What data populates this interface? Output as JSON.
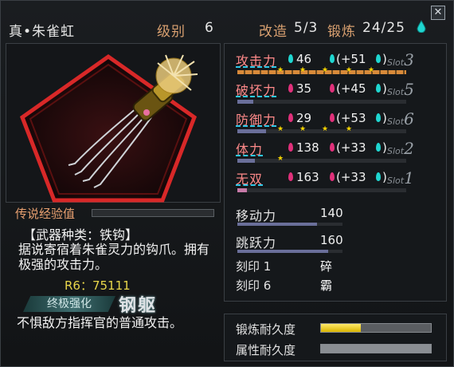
{
  "header": {
    "weapon_name": "真•朱雀虹",
    "level_label": "级别",
    "level_value": "6",
    "modify_label": "改造",
    "modify_value": "5/3",
    "forge_label": "锻炼",
    "forge_value": "24/25",
    "close_glyph": "✕"
  },
  "left": {
    "exp_label": "传说经验值",
    "weapon_type": "【武器种类：铁钩】",
    "lore": "据说寄宿着朱雀灵力的钩爪。拥有极强的攻击力。",
    "rank": "R6：75111",
    "ult_badge": "终极强化",
    "ult_name": "钢躯",
    "skill_desc": "不惧敌方指挥官的普通攻击。"
  },
  "stats": [
    {
      "label": "攻击力",
      "value": "46",
      "bonus": "(+51",
      "slot_word": "Slot",
      "slot_num": "3",
      "gem_color": "#1fd6d0",
      "bar_color": "#d88a3a",
      "stars": 5
    },
    {
      "label": "破坏力",
      "value": "35",
      "bonus": "(+45",
      "slot_word": "Slot",
      "slot_num": "5",
      "gem_color": "#e0307a",
      "bar_color": "#6a6f9a",
      "stars": 0
    },
    {
      "label": "防御力",
      "value": "29",
      "bonus": "(+53",
      "slot_word": "Slot",
      "slot_num": "6",
      "gem_color": "#e0307a",
      "bar_color": "#6a6f9a",
      "stars": 4
    },
    {
      "label": "体力",
      "value": "138",
      "bonus": "(+33",
      "slot_word": "Slot",
      "slot_num": "2",
      "gem_color": "#e0307a",
      "bar_color": "#6a6f9a",
      "stars": 1
    },
    {
      "label": "无双",
      "value": "163",
      "bonus": "(+33",
      "slot_word": "Slot",
      "slot_num": "1",
      "gem_color": "#e0307a",
      "bar_color": "#c77aa8",
      "stars": 0
    }
  ],
  "move": {
    "label": "移动力",
    "value": "140",
    "jump_label": "跳跃力",
    "jump_value": "160"
  },
  "seals": [
    {
      "label": "刻印 1",
      "value": "碎"
    },
    {
      "label": "刻印 6",
      "value": "霸"
    }
  ],
  "durability": {
    "forge_label": "锻炼耐久度",
    "forge_level": 0.36,
    "attr_label": "属性耐久度",
    "attr_level": 1.0
  }
}
